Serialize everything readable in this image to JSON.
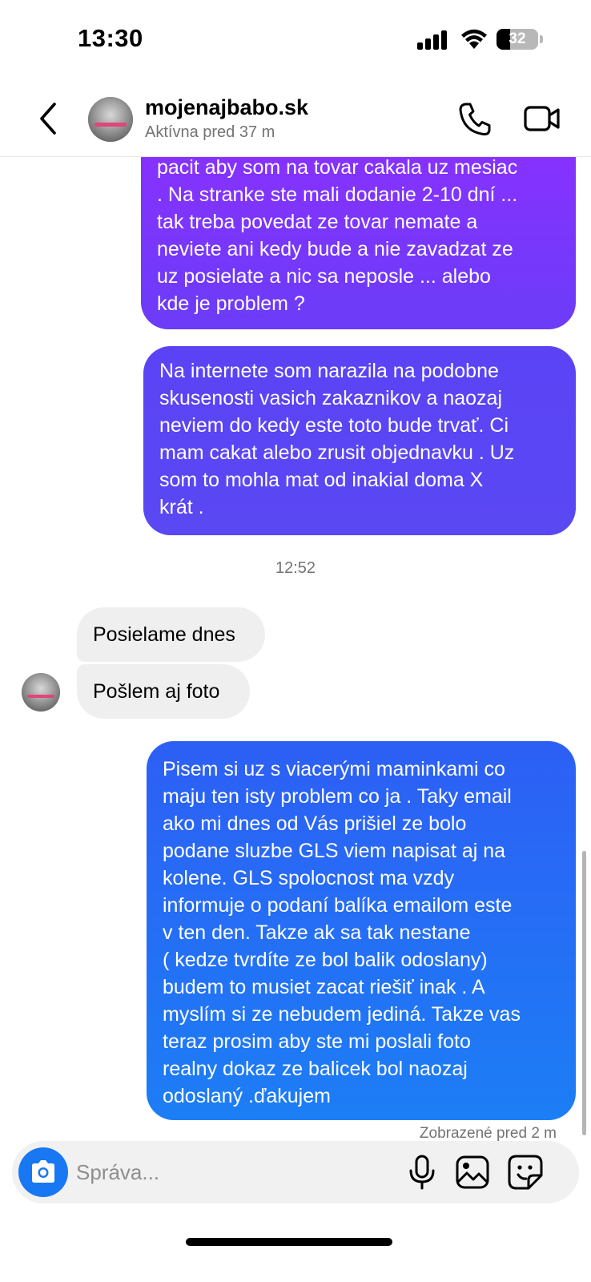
{
  "status_bar": {
    "time": "13:30",
    "battery_level": "32",
    "battery_fraction": 0.32,
    "icons": [
      "signal-icon",
      "wifi-icon",
      "battery-icon"
    ]
  },
  "header": {
    "contact_name": "mojenajbabo.sk",
    "contact_status": "Aktívna pred 37 m",
    "icons": [
      "back-icon",
      "avatar",
      "phone-icon",
      "video-icon"
    ]
  },
  "messages": [
    {
      "id": "msg-out-1",
      "direction": "outgoing",
      "lines": [
        "pacit aby som na tovar cakala uz mesiac",
        ". Na stranke ste mali dodanie 2-10 dní ...",
        "tak treba povedat ze tovar nemate a",
        "neviete ani kedy bude a nie zavadzat ze",
        "uz posielate a nic sa neposle ... alebo",
        "kde je problem ?"
      ]
    },
    {
      "id": "msg-out-2",
      "direction": "outgoing",
      "lines": [
        "Na internete som narazila na podobne",
        "skusenosti vasich zakaznikov a naozaj",
        "neviem do kedy este toto bude trvať. Ci",
        "mam cakat alebo zrusit objednavku . Uz",
        "som to mohla mat od inakial doma X",
        "krát ."
      ]
    },
    {
      "id": "timestamp",
      "text": "12:52"
    },
    {
      "id": "msg-in-1",
      "direction": "incoming",
      "text": "Posielame dnes"
    },
    {
      "id": "msg-in-2",
      "direction": "incoming",
      "text": "Pošlem aj foto"
    },
    {
      "id": "msg-out-3",
      "direction": "outgoing",
      "lines": [
        "Pisem si uz s viacerými maminkami co",
        "maju ten isty problem co ja . Taky email",
        "ako mi dnes od Vás prišiel ze bolo",
        "podane sluzbe GLS viem napisat aj na",
        "kolene. GLS spolocnost ma vzdy",
        "informuje o podaní balíka emailom este",
        "v ten den. Takze ak sa tak nestane",
        "( kedze tvrdíte ze bol balik odoslany)",
        "budem to musiet zacat riešiť inak . A",
        "myslím si ze nebudem jediná. Takze vas",
        "teraz prosim aby ste mi poslali foto",
        "realny dokaz ze balicek bol naozaj",
        "odoslaný .ďakujem"
      ]
    }
  ],
  "seen_status": "Zobrazené pred 2 m",
  "composer": {
    "placeholder": "Správa...",
    "icons": [
      "camera-icon",
      "microphone-icon",
      "gallery-icon",
      "sticker-icon"
    ]
  },
  "colors": {
    "bubble_top": "#8a30ff",
    "bubble_mid": "#5b43f5",
    "bubble_bottom": "#1c7ef5",
    "incoming_bubble": "#efefef",
    "camera_button": "#1877f2",
    "muted_text": "#737373"
  }
}
